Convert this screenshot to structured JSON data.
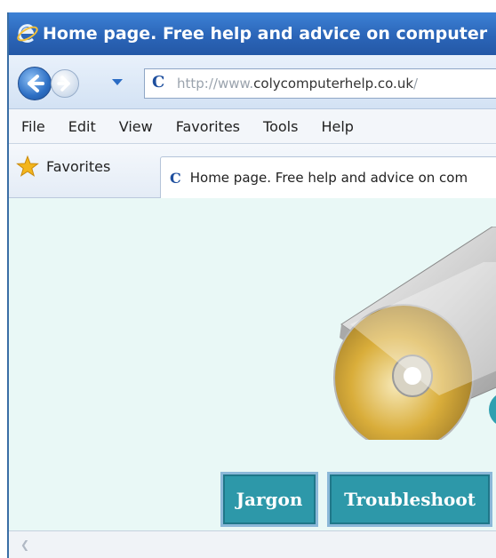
{
  "window": {
    "title": "Home page. Free help and advice on computer"
  },
  "address_bar": {
    "url_prefix": "http://www.",
    "url_domain": "colycomputerhelp.co.uk",
    "url_suffix": "/"
  },
  "menu": {
    "items": [
      {
        "label": "File"
      },
      {
        "label": "Edit"
      },
      {
        "label": "View"
      },
      {
        "label": "Favorites"
      },
      {
        "label": "Tools"
      },
      {
        "label": "Help"
      }
    ]
  },
  "favorites_bar": {
    "favorites_label": "Favorites",
    "tab_title": "Home page. Free help and advice on com"
  },
  "page": {
    "buttons": [
      {
        "label": "Jargon"
      },
      {
        "label": "Troubleshoot"
      }
    ]
  },
  "colors": {
    "title_bar": "#2b65b8",
    "content_bg": "#e9f8f6",
    "nav_button": "#2d98a9"
  },
  "icons": [
    "ie-logo-icon",
    "back-arrow-icon",
    "forward-arrow-icon",
    "dropdown-arrow-icon",
    "site-favicon-icon",
    "favorites-star-icon",
    "cd-drive-illustration",
    "scroll-left-icon"
  ]
}
